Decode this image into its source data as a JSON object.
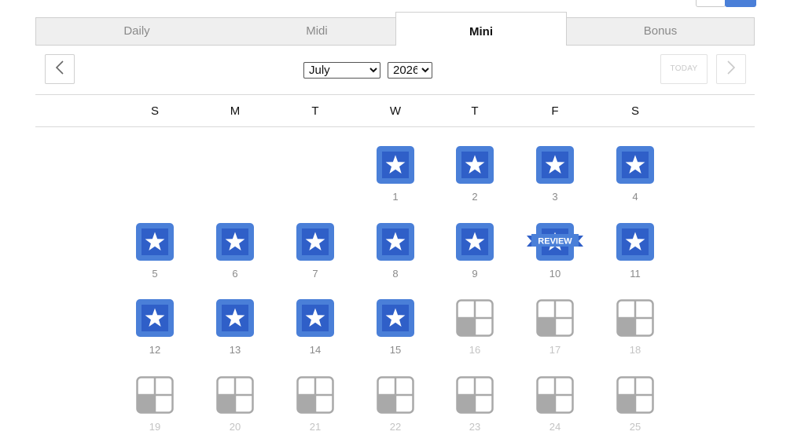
{
  "tabs": [
    {
      "label": "Daily",
      "active": false
    },
    {
      "label": "Midi",
      "active": false
    },
    {
      "label": "Mini",
      "active": true
    },
    {
      "label": "Bonus",
      "active": false
    }
  ],
  "nav": {
    "prev_icon": "chevron-left-icon",
    "next_icon": "chevron-right-icon",
    "month_selected": "July",
    "year_selected": "2026",
    "today_label": "TODAY"
  },
  "weekdays": [
    "S",
    "M",
    "T",
    "W",
    "T",
    "F",
    "S"
  ],
  "calendar": {
    "colors": {
      "accent": "#4a7fd8",
      "accent_dark": "#2f5fc8",
      "future_icon": "#a9a9a9"
    },
    "review_label": "REVIEW",
    "days": [
      {
        "day": "1",
        "state": "solved"
      },
      {
        "day": "2",
        "state": "solved"
      },
      {
        "day": "3",
        "state": "solved"
      },
      {
        "day": "4",
        "state": "solved"
      },
      {
        "day": "5",
        "state": "solved"
      },
      {
        "day": "6",
        "state": "solved"
      },
      {
        "day": "7",
        "state": "solved"
      },
      {
        "day": "8",
        "state": "solved"
      },
      {
        "day": "9",
        "state": "solved"
      },
      {
        "day": "10",
        "state": "review"
      },
      {
        "day": "11",
        "state": "solved"
      },
      {
        "day": "12",
        "state": "solved"
      },
      {
        "day": "13",
        "state": "solved"
      },
      {
        "day": "14",
        "state": "solved"
      },
      {
        "day": "15",
        "state": "solved"
      },
      {
        "day": "16",
        "state": "future"
      },
      {
        "day": "17",
        "state": "future"
      },
      {
        "day": "18",
        "state": "future"
      },
      {
        "day": "19",
        "state": "future"
      },
      {
        "day": "20",
        "state": "future"
      },
      {
        "day": "21",
        "state": "future"
      },
      {
        "day": "22",
        "state": "future"
      },
      {
        "day": "23",
        "state": "future"
      },
      {
        "day": "24",
        "state": "future"
      },
      {
        "day": "25",
        "state": "future"
      }
    ]
  }
}
